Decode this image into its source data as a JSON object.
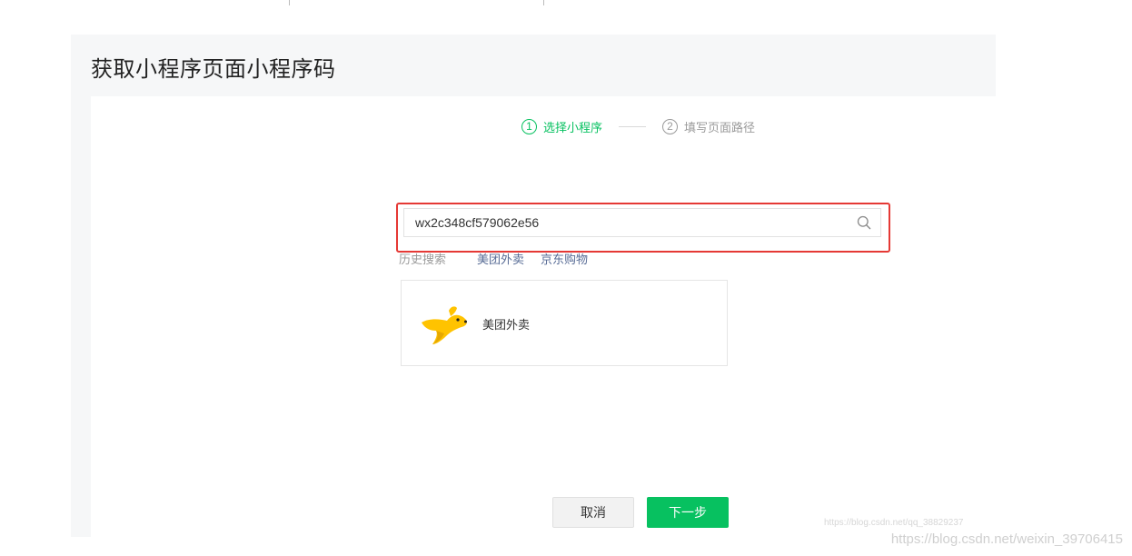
{
  "page": {
    "title": "获取小程序页面小程序码"
  },
  "steps": [
    {
      "number": "1",
      "label": "选择小程序",
      "state": "active"
    },
    {
      "number": "2",
      "label": "填写页面路径",
      "state": "inactive"
    }
  ],
  "search": {
    "value": "wx2c348cf579062e56",
    "icon": "search-icon"
  },
  "history": {
    "label": "历史搜索",
    "items": [
      "美团外卖",
      "京东购物"
    ]
  },
  "result": {
    "name": "美团外卖",
    "icon": "meituan-kangaroo-logo"
  },
  "buttons": {
    "cancel": "取消",
    "next": "下一步"
  },
  "watermarks": {
    "small": "https://blog.csdn.net/qq_38829237",
    "large": "https://blog.csdn.net/weixin_39706415"
  },
  "colors": {
    "accent": "#07c160",
    "highlight": "#e53935",
    "link": "#576b95"
  }
}
